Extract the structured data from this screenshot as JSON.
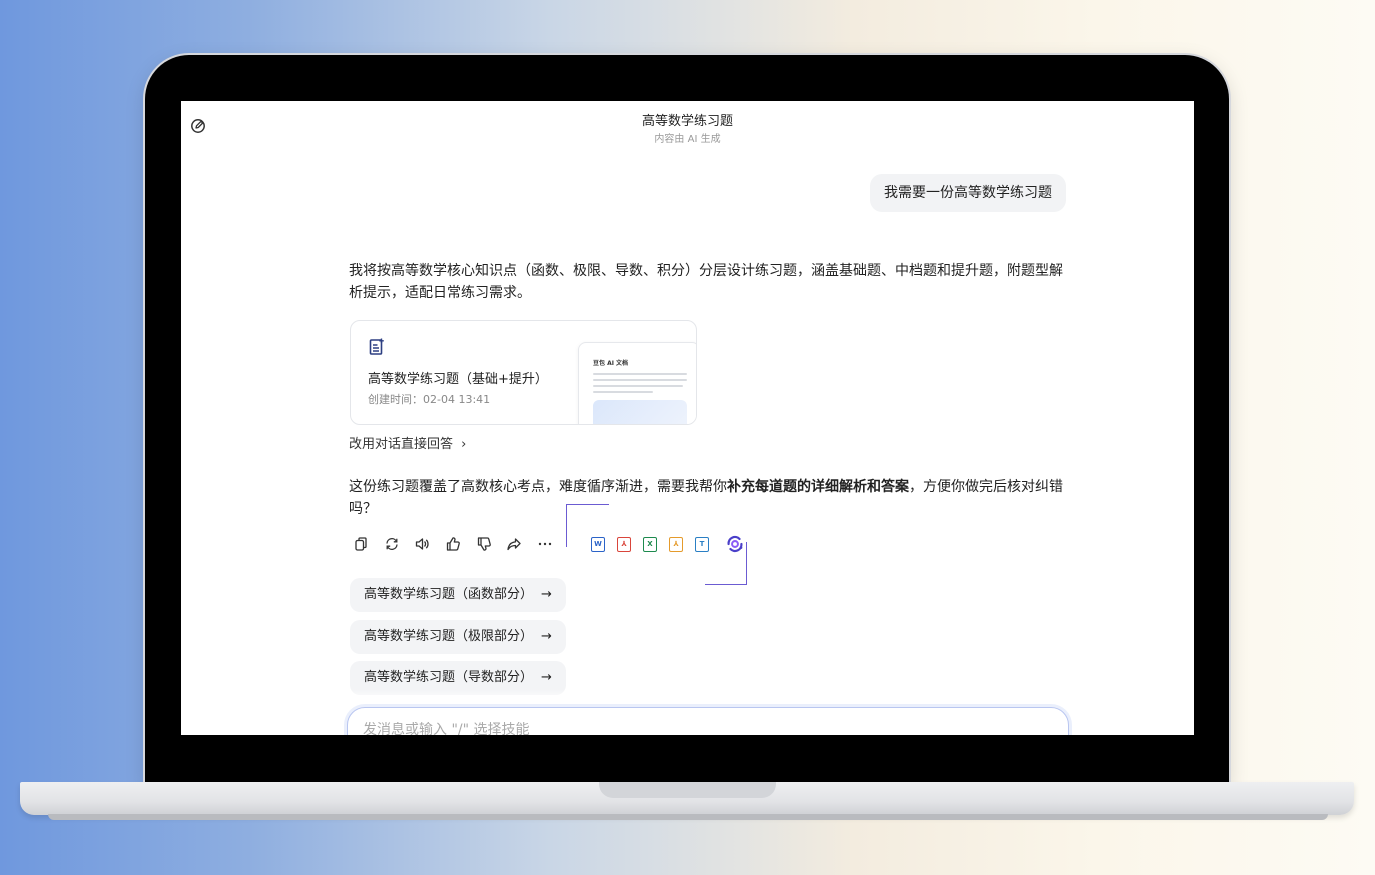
{
  "header": {
    "title": "高等数学练习题",
    "subtitle": "内容由 AI 生成"
  },
  "messages": {
    "user": "我需要一份高等数学练习题",
    "ai_intro": "我将按高等数学核心知识点（函数、极限、导数、积分）分层设计练习题，涵盖基础题、中档题和提升题，附题型解析提示，适配日常练习需求。",
    "doc_card": {
      "title": "高等数学练习题（基础+提升）",
      "created": "创建时间：02-04 13:41",
      "thumb_title": "豆包 AI 文档"
    },
    "switch_link": "改用对话直接回答",
    "ai_follow_before": "这份练习题覆盖了高数核心考点，难度循序渐进，需要我帮你",
    "ai_follow_bold": "补充每道题的详细解析和答案",
    "ai_follow_after": "，方便你做完后核对纠错吗？"
  },
  "toolbar": {
    "icons": [
      "copy-icon",
      "regenerate-icon",
      "speaker-icon",
      "thumbs-up-icon",
      "thumbs-down-icon",
      "share-icon",
      "more-icon"
    ],
    "formats": [
      {
        "name": "word-icon",
        "glyph": "W",
        "color": "#2b63c8"
      },
      {
        "name": "pdf-icon",
        "glyph": "⅄",
        "color": "#d9453b"
      },
      {
        "name": "excel-icon",
        "glyph": "X",
        "color": "#1d8a4e"
      },
      {
        "name": "ppt-icon",
        "glyph": "⅄",
        "color": "#e59b2c"
      },
      {
        "name": "text-icon",
        "glyph": "T",
        "color": "#2a7fc4"
      }
    ]
  },
  "suggestions": [
    "高等数学练习题（函数部分）",
    "高等数学练习题（极限部分）",
    "高等数学练习题（导数部分）"
  ],
  "input": {
    "placeholder": "发消息或输入 \"/\" 选择技能"
  }
}
